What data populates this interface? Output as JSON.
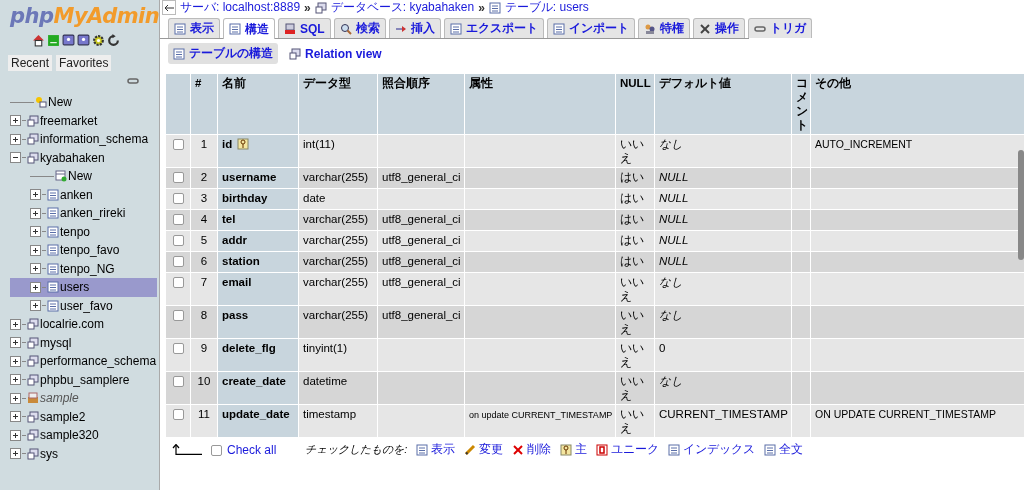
{
  "logo": {
    "prefix": "php",
    "suffix": "MyAdmin"
  },
  "sidebar_tabs": [
    "Recent",
    "Favorites"
  ],
  "tree": [
    {
      "label": "New",
      "kind": "new",
      "selected": false,
      "italic": false
    },
    {
      "label": "freemarket",
      "kind": "database",
      "expanded": false,
      "selected": false,
      "italic": false
    },
    {
      "label": "information_schema",
      "kind": "database",
      "expanded": false,
      "selected": false,
      "italic": false
    },
    {
      "label": "kyabahaken",
      "kind": "database",
      "expanded": true,
      "selected": false,
      "italic": false,
      "children": [
        {
          "label": "New",
          "kind": "newtable",
          "selected": false,
          "italic": false
        },
        {
          "label": "anken",
          "kind": "table",
          "expanded": false,
          "selected": false,
          "italic": false
        },
        {
          "label": "anken_rireki",
          "kind": "table",
          "expanded": false,
          "selected": false,
          "italic": false
        },
        {
          "label": "tenpo",
          "kind": "table",
          "expanded": false,
          "selected": false,
          "italic": false
        },
        {
          "label": "tenpo_favo",
          "kind": "table",
          "expanded": false,
          "selected": false,
          "italic": false
        },
        {
          "label": "tenpo_NG",
          "kind": "table",
          "expanded": false,
          "selected": false,
          "italic": false
        },
        {
          "label": "users",
          "kind": "table",
          "expanded": false,
          "selected": true,
          "italic": false
        },
        {
          "label": "user_favo",
          "kind": "table",
          "expanded": false,
          "selected": false,
          "italic": false
        }
      ]
    },
    {
      "label": "localrie.com",
      "kind": "database",
      "expanded": false,
      "selected": false,
      "italic": false
    },
    {
      "label": "mysql",
      "kind": "database",
      "expanded": false,
      "selected": false,
      "italic": false
    },
    {
      "label": "performance_schema",
      "kind": "database",
      "expanded": false,
      "selected": false,
      "italic": false
    },
    {
      "label": "phpbu_samplere",
      "kind": "database",
      "expanded": false,
      "selected": false,
      "italic": false
    },
    {
      "label": "sample",
      "kind": "box",
      "expanded": false,
      "selected": false,
      "italic": true
    },
    {
      "label": "sample2",
      "kind": "database",
      "expanded": false,
      "selected": false,
      "italic": false
    },
    {
      "label": "sample320",
      "kind": "database",
      "expanded": false,
      "selected": false,
      "italic": false
    },
    {
      "label": "sys",
      "kind": "database",
      "expanded": false,
      "selected": false,
      "italic": false
    }
  ],
  "breadcrumb": {
    "items": [
      "サーバ: localhost:8889",
      "データベース: kyabahaken",
      "テーブル: users"
    ],
    "separators": [
      "»",
      "»"
    ]
  },
  "tabs": [
    {
      "label": "表示",
      "selected": false
    },
    {
      "label": "構造",
      "selected": true
    },
    {
      "label": "SQL",
      "selected": false
    },
    {
      "label": "検索",
      "selected": false
    },
    {
      "label": "挿入",
      "selected": false
    },
    {
      "label": "エクスポート",
      "selected": false
    },
    {
      "label": "インポート",
      "selected": false
    },
    {
      "label": "特権",
      "selected": false
    },
    {
      "label": "操作",
      "selected": false
    },
    {
      "label": "トリガ",
      "selected": false
    }
  ],
  "subtabs": [
    {
      "label": "テーブルの構造",
      "selected": true
    },
    {
      "label": "Relation view",
      "selected": false
    }
  ],
  "table": {
    "columns": [
      "#",
      "名前",
      "データ型",
      "照合順序",
      "属性",
      "NULL",
      "デフォルト値",
      "コメント",
      "その他"
    ],
    "rows": [
      {
        "num": "1",
        "name": "id",
        "primary": true,
        "type": "int(11)",
        "collation": "",
        "attributes": "",
        "null": "いいえ",
        "default": "なし",
        "default_italic": true,
        "extra": "AUTO_INCREMENT",
        "checked": false
      },
      {
        "num": "2",
        "name": "username",
        "primary": false,
        "type": "varchar(255)",
        "collation": "utf8_general_ci",
        "attributes": "",
        "null": "はい",
        "default": "NULL",
        "default_italic": true,
        "extra": "",
        "checked": false
      },
      {
        "num": "3",
        "name": "birthday",
        "primary": false,
        "type": "date",
        "collation": "",
        "attributes": "",
        "null": "はい",
        "default": "NULL",
        "default_italic": true,
        "extra": "",
        "checked": false
      },
      {
        "num": "4",
        "name": "tel",
        "primary": false,
        "type": "varchar(255)",
        "collation": "utf8_general_ci",
        "attributes": "",
        "null": "はい",
        "default": "NULL",
        "default_italic": true,
        "extra": "",
        "checked": false
      },
      {
        "num": "5",
        "name": "addr",
        "primary": false,
        "type": "varchar(255)",
        "collation": "utf8_general_ci",
        "attributes": "",
        "null": "はい",
        "default": "NULL",
        "default_italic": true,
        "extra": "",
        "checked": false
      },
      {
        "num": "6",
        "name": "station",
        "primary": false,
        "type": "varchar(255)",
        "collation": "utf8_general_ci",
        "attributes": "",
        "null": "はい",
        "default": "NULL",
        "default_italic": true,
        "extra": "",
        "checked": false
      },
      {
        "num": "7",
        "name": "email",
        "primary": false,
        "type": "varchar(255)",
        "collation": "utf8_general_ci",
        "attributes": "",
        "null": "いいえ",
        "default": "なし",
        "default_italic": true,
        "extra": "",
        "checked": false
      },
      {
        "num": "8",
        "name": "pass",
        "primary": false,
        "type": "varchar(255)",
        "collation": "utf8_general_ci",
        "attributes": "",
        "null": "いいえ",
        "default": "なし",
        "default_italic": true,
        "extra": "",
        "checked": false
      },
      {
        "num": "9",
        "name": "delete_flg",
        "primary": false,
        "type": "tinyint(1)",
        "collation": "",
        "attributes": "",
        "null": "いいえ",
        "default": "0",
        "default_italic": false,
        "extra": "",
        "checked": false
      },
      {
        "num": "10",
        "name": "create_date",
        "primary": false,
        "type": "datetime",
        "collation": "",
        "attributes": "",
        "null": "いいえ",
        "default": "なし",
        "default_italic": true,
        "extra": "",
        "checked": false
      },
      {
        "num": "11",
        "name": "update_date",
        "primary": false,
        "type": "timestamp",
        "collation": "",
        "attributes": "on update CURRENT_TIMESTAMP",
        "null": "いいえ",
        "default": "CURRENT_TIMESTAMP",
        "default_italic": false,
        "extra": "ON UPDATE CURRENT_TIMESTAMP",
        "checked": false
      }
    ]
  },
  "footer": {
    "check_all": {
      "label": "Check all",
      "checked": false
    },
    "with_selected": "チェックしたものを:",
    "actions": [
      "表示",
      "変更",
      "削除",
      "主",
      "ユニーク",
      "インデックス",
      "全文"
    ]
  }
}
